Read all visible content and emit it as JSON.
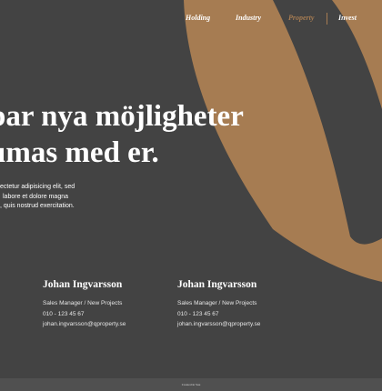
{
  "nav": {
    "items": [
      {
        "label": "Holding"
      },
      {
        "label": "Industry"
      },
      {
        "label": "Property"
      },
      {
        "label": "Invest"
      }
    ],
    "active_index": 2
  },
  "hero": {
    "headline_line1": "par nya möjligheter",
    "headline_line2": "umas med er.",
    "intro_line1": "ectetur adipisicing elit, sed",
    "intro_line2": "labore et dolore magna",
    "intro_line3": ", quis nostrud exercitation."
  },
  "contacts": [
    {
      "name": "Johan Ingvarsson",
      "title": "Sales Manager / New Projects",
      "phone": "010 - 123 45 67",
      "email": "johan.ingvarsson@qproperty.se"
    },
    {
      "name": "Johan Ingvarsson",
      "title": "Sales Manager / New Projects",
      "phone": "010 - 123 45 67",
      "email": "johan.ingvarsson@qproperty.se"
    }
  ],
  "footer": {
    "credit": "Created in Sue"
  },
  "colors": {
    "background": "#434343",
    "accent": "#a67c52",
    "text": "#ffffff"
  },
  "decoration": {
    "shape": "brand-logo-swoosh"
  }
}
